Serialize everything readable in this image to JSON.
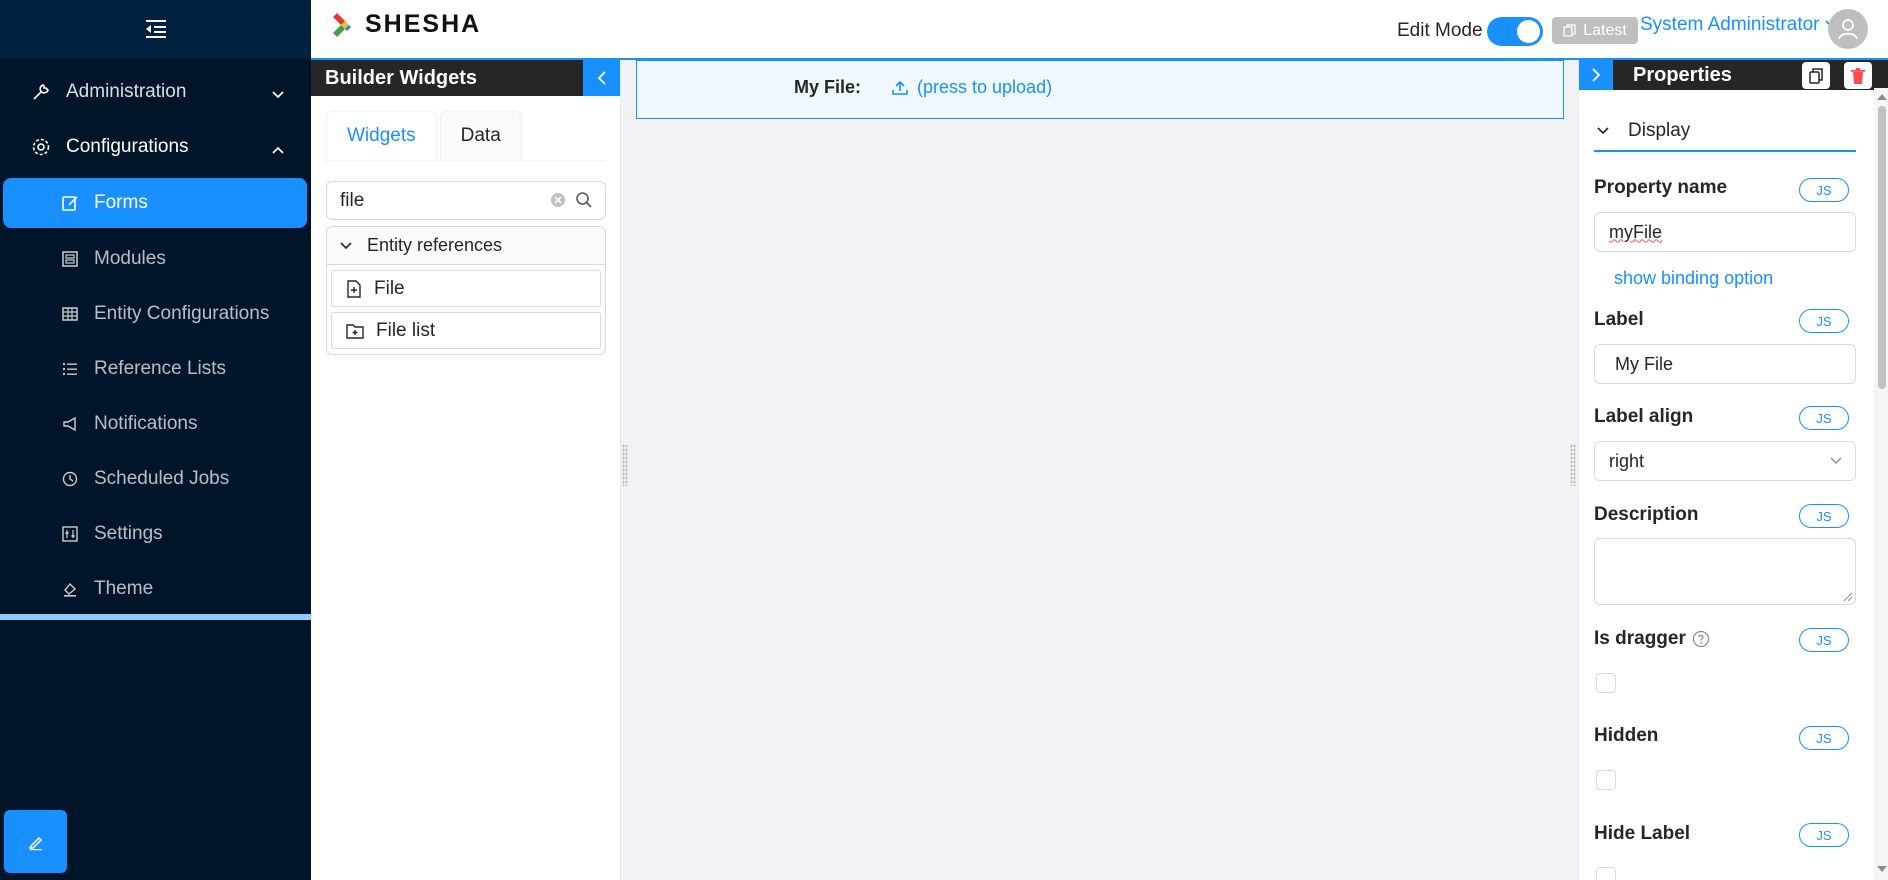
{
  "brand": {
    "name": "SHESHA"
  },
  "sidebar": {
    "administration": "Administration",
    "configurations": "Configurations",
    "items": [
      {
        "label": "Forms",
        "icon": "form-icon",
        "active": true
      },
      {
        "label": "Modules",
        "icon": "modules-icon"
      },
      {
        "label": "Entity Configurations",
        "icon": "table-icon"
      },
      {
        "label": "Reference Lists",
        "icon": "list-icon"
      },
      {
        "label": "Notifications",
        "icon": "megaphone-icon"
      },
      {
        "label": "Scheduled Jobs",
        "icon": "clock-icon"
      },
      {
        "label": "Settings",
        "icon": "sliders-icon"
      },
      {
        "label": "Theme",
        "icon": "paint-icon"
      }
    ]
  },
  "header": {
    "edit_mode": "Edit Mode",
    "edit_mode_on": true,
    "latest": "Latest",
    "user": "System Administrator"
  },
  "widgets_panel": {
    "title": "Builder Widgets",
    "tabs": [
      "Widgets",
      "Data"
    ],
    "active_tab": "Widgets",
    "search_value": "file",
    "group": "Entity references",
    "items": [
      "File",
      "File list"
    ]
  },
  "canvas": {
    "field_label": "My File:",
    "upload_text": "(press to upload)"
  },
  "properties": {
    "title": "Properties",
    "section": "Display",
    "js": "JS",
    "property_name_label": "Property name",
    "property_name_value": "myFile",
    "binding_link": "show binding option",
    "label_label": "Label",
    "label_value": "My File",
    "label_align_label": "Label align",
    "label_align_value": "right",
    "description_label": "Description",
    "description_value": "",
    "is_dragger_label": "Is dragger",
    "hidden_label": "Hidden",
    "hide_label_label": "Hide Label"
  },
  "colors": {
    "primary": "#1890ff",
    "sidebar_bg": "#001529",
    "danger": "#ff4d4f"
  }
}
